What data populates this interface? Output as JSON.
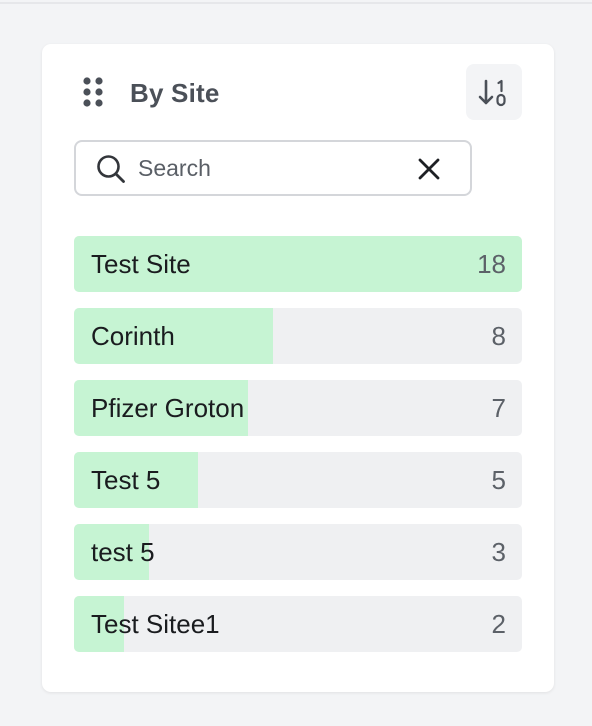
{
  "panel": {
    "title": "By Site",
    "search": {
      "placeholder": "Search",
      "value": ""
    },
    "sort_icon": "sort-numeric-descending-icon",
    "max_count": 18,
    "items": [
      {
        "label": "Test Site",
        "count": 18
      },
      {
        "label": "Corinth",
        "count": 8
      },
      {
        "label": "Pfizer Groton",
        "count": 7
      },
      {
        "label": "Test 5",
        "count": 5
      },
      {
        "label": "test 5",
        "count": 3
      },
      {
        "label": "Test Sitee1",
        "count": 2
      }
    ]
  },
  "colors": {
    "bar_fill": "#c6f4d3",
    "bar_track": "#eff0f2",
    "title": "#4b5058"
  }
}
